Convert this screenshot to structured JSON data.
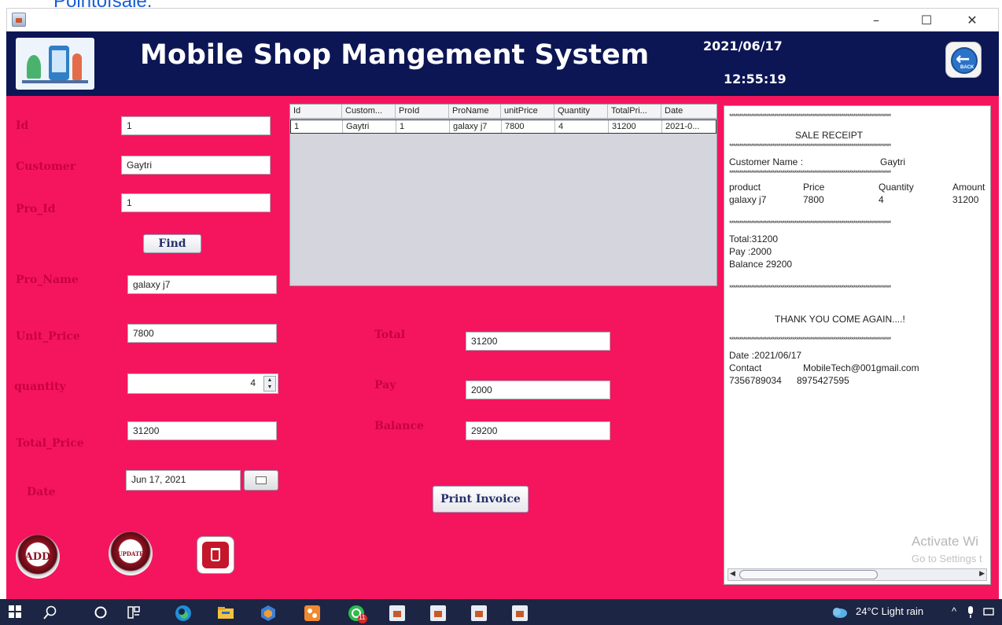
{
  "top_caption": "Pointofsale.",
  "window": {
    "minimize": "–",
    "maximize": "☐",
    "close": "✕"
  },
  "header": {
    "title": "Mobile Shop Mangement System",
    "date": "2021/06/17",
    "time": "12:55:19",
    "back_label": "BACK"
  },
  "form": {
    "id_label": "Id",
    "id_value": "1",
    "customer_label": "Customer",
    "customer_value": "Gaytri",
    "pro_id_label": "Pro_Id",
    "pro_id_value": "1",
    "find_label": "Find",
    "pro_name_label": "Pro_Name",
    "pro_name_value": "galaxy j7",
    "unit_price_label": "Unit_Price",
    "unit_price_value": "7800",
    "quantity_label": "quantity",
    "quantity_value": "4",
    "total_price_label": "Total_Price",
    "total_price_value": "31200",
    "date_label": "Date",
    "date_value": "Jun 17, 2021"
  },
  "table": {
    "headers": [
      "Id",
      "Custom...",
      "ProId",
      "ProName",
      "unitPrice",
      "Quantity",
      "TotalPri...",
      "Date"
    ],
    "rows": [
      [
        "1",
        "Gaytri",
        "1",
        "galaxy j7",
        "7800",
        "4",
        "31200",
        "2021-0..."
      ]
    ]
  },
  "totals": {
    "total_label": "Total",
    "total_value": "31200",
    "pay_label": "Pay",
    "pay_value": "2000",
    "balance_label": "Balance",
    "balance_value": "29200",
    "print_label": "Print Invoice"
  },
  "actions": {
    "add_label": "ADD",
    "update_label": "UPDATE"
  },
  "receipt": {
    "stars": "**********************************************************************************",
    "heading": "SALE RECEIPT",
    "customer_name_label": "Customer Name :",
    "customer_name_value": "Gaytri",
    "col_product": "product",
    "col_price": "Price",
    "col_quantity": "Quantity",
    "col_amount": "Amount",
    "item_product": "galaxy j7",
    "item_price": "7800",
    "item_quantity": "4",
    "item_amount": "31200",
    "total_line": "Total:31200",
    "pay_line": "Pay :2000",
    "balance_line": "Balance 29200",
    "thanks": "THANK YOU COME AGAIN....!",
    "date_line": "Date :2021/06/17",
    "contact_label": "Contact",
    "contact_email": "MobileTech@001gmail.com",
    "phone1": "7356789034",
    "phone2": "8975427595",
    "watermark_title": "Activate Wi",
    "watermark_sub": "Go to Settings t"
  },
  "taskbar": {
    "weather": "24°C  Light rain",
    "badge": "11"
  },
  "colors": {
    "pink": "#f5155f",
    "navy": "#0c1654",
    "label": "#c8003e",
    "taskbar": "#1c2544"
  }
}
